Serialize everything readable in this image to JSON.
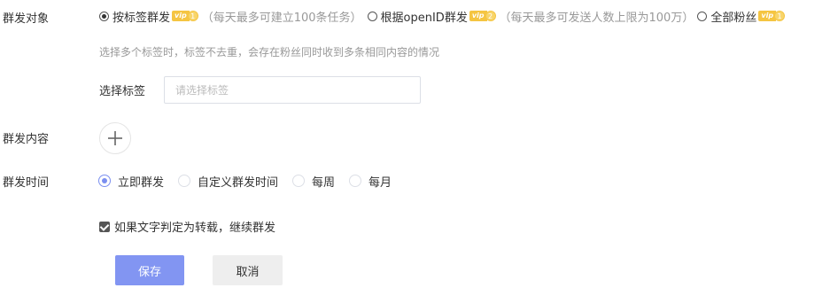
{
  "form": {
    "target": {
      "label": "群发对象",
      "options": [
        {
          "label": "按标签群发",
          "vip_text": "vip",
          "vip_level": "1",
          "note": "（每天最多可建立100条任务）",
          "checked": true
        },
        {
          "label": "根据openID群发",
          "vip_text": "vip",
          "vip_level": "2",
          "note": "（每天最多可发送人数上限为100万）",
          "checked": false
        },
        {
          "label": "全部粉丝",
          "vip_text": "vip",
          "vip_level": "1",
          "checked": false
        }
      ],
      "hint": "选择多个标签时，标签不去重，会存在粉丝同时收到多条相同内容的情况"
    },
    "tags": {
      "label": "选择标签",
      "placeholder": "请选择标签",
      "value": ""
    },
    "content": {
      "label": "群发内容",
      "add_icon": "plus-icon"
    },
    "time": {
      "label": "群发时间",
      "options": [
        {
          "label": "立即群发",
          "checked": true
        },
        {
          "label": "自定义群发时间",
          "checked": false
        },
        {
          "label": "每周",
          "checked": false
        },
        {
          "label": "每月",
          "checked": false
        }
      ]
    },
    "reprint": {
      "label": "如果文字判定为转载，继续群发",
      "checked": true
    }
  },
  "actions": {
    "save_label": "保存",
    "cancel_label": "取消"
  },
  "colors": {
    "primary": "#8295f2",
    "vip": "#f5c542",
    "hint": "#999999"
  }
}
